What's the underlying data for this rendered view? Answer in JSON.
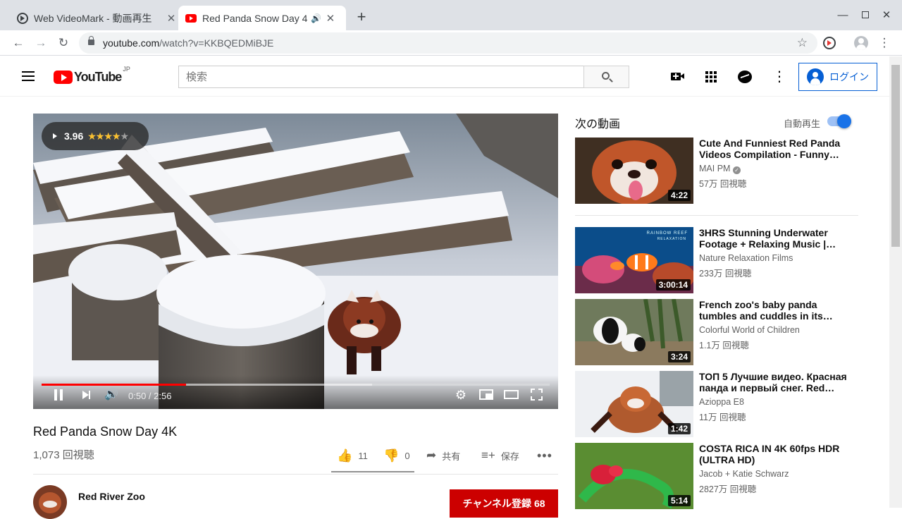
{
  "browser": {
    "tabs": [
      {
        "title": "Web VideoMark - 動画再生",
        "active": false
      },
      {
        "title": "Red Panda Snow Day 4",
        "active": true
      }
    ],
    "new_tab": "+",
    "url_domain": "youtube.com",
    "url_path": "/watch?v=KKBQEDMiBJE"
  },
  "header": {
    "logo_text": "YouTube",
    "logo_region": "JP",
    "search_placeholder": "検索",
    "login_label": "ログイン"
  },
  "player": {
    "rating": "3.96",
    "rating_value": 3.96,
    "rating_stars": "★★★★★",
    "time": "0:50 / 2:56",
    "progress_fraction": 0.284,
    "buffered_fraction": 0.65
  },
  "video": {
    "title": "Red Panda Snow Day 4K",
    "views": "1,073 回視聴",
    "likes": "11",
    "dislikes": "0",
    "share_label": "共有",
    "save_label": "保存",
    "channel": "Red River Zoo",
    "subscribe_label": "チャンネル登録 68"
  },
  "sidebar": {
    "up_next_label": "次の動画",
    "autoplay_label": "自動再生",
    "autoplay_on": true,
    "items": [
      {
        "title": "Cute And Funniest Red Panda Videos Compilation - Funny…",
        "channel": "MAI PM",
        "verified": true,
        "views": "57万 回視聴",
        "duration": "4:22"
      },
      {
        "title": "3HRS Stunning Underwater Footage + Relaxing Music |…",
        "channel": "Nature Relaxation Films",
        "verified": false,
        "views": "233万 回視聴",
        "duration": "3:00:14"
      },
      {
        "title": "French zoo's baby panda tumbles and cuddles in its…",
        "channel": "Colorful World of Children",
        "verified": false,
        "views": "1.1万 回視聴",
        "duration": "3:24"
      },
      {
        "title": "ТОП 5 Лучшие видео. Красная панда и первый снег. Red…",
        "channel": "Azioppa E8",
        "verified": false,
        "views": "11万 回視聴",
        "duration": "1:42"
      },
      {
        "title": "COSTA RICA IN 4K 60fps HDR (ULTRA HD)",
        "channel": "Jacob + Katie Schwarz",
        "verified": false,
        "views": "2827万 回視聴",
        "duration": "5:14"
      }
    ],
    "thumb_texts": {
      "reef_brand": "RAINBOW REEF",
      "reef_sub": "RELAXATION"
    }
  },
  "colors": {
    "brand_red": "#ff0000",
    "link_blue": "#065fd4",
    "subscribe_red": "#cc0000",
    "toggle_blue": "#1a73e8"
  },
  "icons": [
    "menu-icon",
    "search-icon",
    "create-video-icon",
    "apps-icon",
    "messages-icon",
    "more-vert-icon",
    "account-icon",
    "play-icon",
    "pause-icon",
    "next-icon",
    "volume-icon",
    "settings-icon",
    "miniplayer-icon",
    "theater-icon",
    "fullscreen-icon",
    "like-icon",
    "dislike-icon",
    "share-icon",
    "save-icon",
    "lock-icon",
    "star-icon",
    "reload-icon",
    "back-icon",
    "forward-icon"
  ]
}
